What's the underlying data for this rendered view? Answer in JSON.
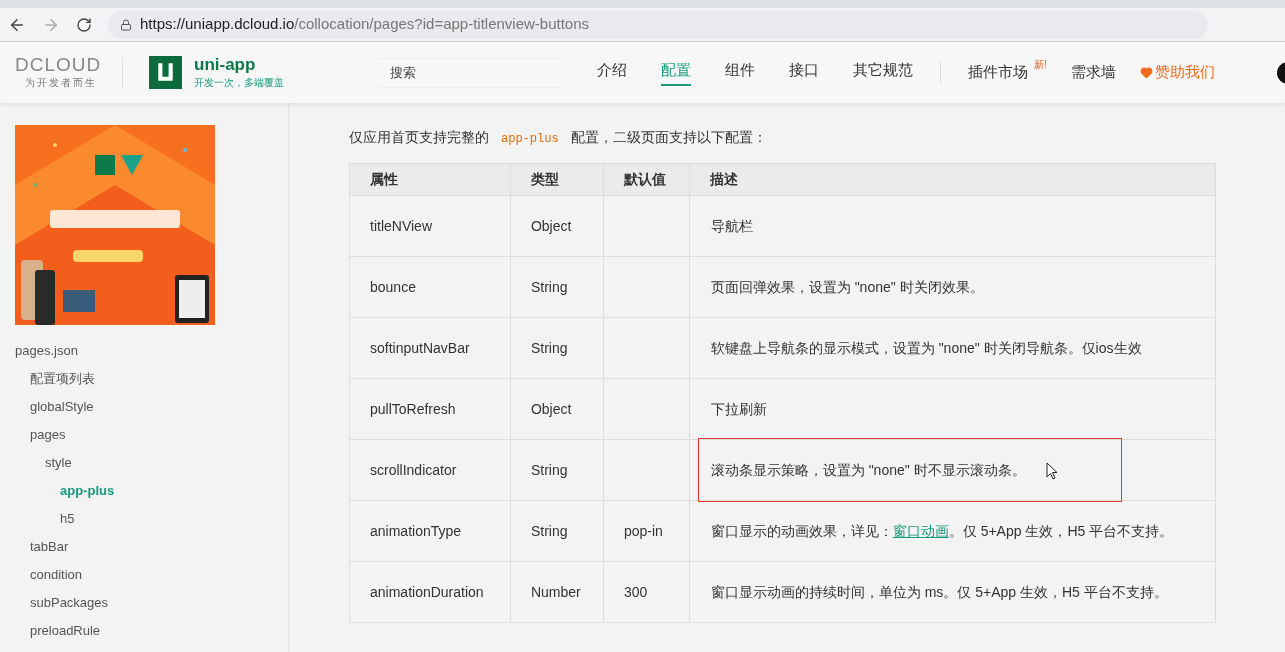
{
  "browser": {
    "url_host": "https://uniapp.dcloud.io",
    "url_path": "/collocation/pages?id=app-titlenview-buttons"
  },
  "header": {
    "dcloud": {
      "wordmark": "DCLOUD",
      "tagline": "为开发者而生"
    },
    "product": {
      "name": "uni-app",
      "tagline": "开发一次，多端覆盖"
    },
    "search": {
      "placeholder": "搜索"
    },
    "nav": [
      {
        "label": "介绍",
        "selected": false
      },
      {
        "label": "配置",
        "selected": true
      },
      {
        "label": "组件",
        "selected": false
      },
      {
        "label": "接口",
        "selected": false
      },
      {
        "label": "其它规范",
        "selected": false
      }
    ],
    "links": [
      {
        "label": "插件市场",
        "badge": "新!"
      },
      {
        "label": "需求墙"
      }
    ],
    "sponsor": {
      "label": "赞助我们"
    }
  },
  "sidebar": {
    "tree": [
      {
        "label": "pages.json",
        "selected": false,
        "children": [
          {
            "label": "配置项列表",
            "selected": false
          },
          {
            "label": "globalStyle",
            "selected": false
          },
          {
            "label": "pages",
            "selected": false,
            "children": [
              {
                "label": "style",
                "selected": false,
                "children": [
                  {
                    "label": "app-plus",
                    "selected": true
                  },
                  {
                    "label": "h5",
                    "selected": false
                  }
                ]
              }
            ]
          },
          {
            "label": "tabBar",
            "selected": false
          },
          {
            "label": "condition",
            "selected": false
          },
          {
            "label": "subPackages",
            "selected": false
          },
          {
            "label": "preloadRule",
            "selected": false
          }
        ]
      }
    ]
  },
  "content": {
    "intro": [
      {
        "kind": "text",
        "text": "仅应用首页支持完整的"
      },
      {
        "kind": "code",
        "text": "app-plus"
      },
      {
        "kind": "text",
        "text": "配置，二级页面支持以下配置："
      }
    ],
    "table": {
      "columns": [
        "属性",
        "类型",
        "默认值",
        "描述"
      ],
      "rows": [
        {
          "name": "titleNView",
          "type": "Object",
          "default": "",
          "highlighted": false,
          "description": [
            {
              "kind": "text",
              "text": "导航栏"
            }
          ]
        },
        {
          "name": "bounce",
          "type": "String",
          "default": "",
          "highlighted": false,
          "description": [
            {
              "kind": "text",
              "text": "页面回弹效果，设置为 \"none\" 时关闭效果。"
            }
          ]
        },
        {
          "name": "softinputNavBar",
          "type": "String",
          "default": "",
          "highlighted": false,
          "description": [
            {
              "kind": "text",
              "text": "软键盘上导航条的显示模式，设置为 \"none\" 时关闭导航条。仅ios生效"
            }
          ]
        },
        {
          "name": "pullToRefresh",
          "type": "Object",
          "default": "",
          "highlighted": false,
          "description": [
            {
              "kind": "text",
              "text": "下拉刷新"
            }
          ]
        },
        {
          "name": "scrollIndicator",
          "type": "String",
          "default": "",
          "highlighted": true,
          "description": [
            {
              "kind": "text",
              "text": "滚动条显示策略，设置为 \"none\" 时不显示滚动条。"
            }
          ]
        },
        {
          "name": "animationType",
          "type": "String",
          "default": "pop-in",
          "highlighted": false,
          "description": [
            {
              "kind": "text",
              "text": "窗口显示的动画效果，详见："
            },
            {
              "kind": "link",
              "text": "窗口动画"
            },
            {
              "kind": "text",
              "text": "。仅 5+App 生效，H5 平台不支持。"
            }
          ]
        },
        {
          "name": "animationDuration",
          "type": "Number",
          "default": "300",
          "highlighted": false,
          "description": [
            {
              "kind": "text",
              "text": "窗口显示动画的持续时间，单位为 ms。仅 5+App 生效，H5 平台不支持。"
            }
          ]
        }
      ]
    }
  }
}
